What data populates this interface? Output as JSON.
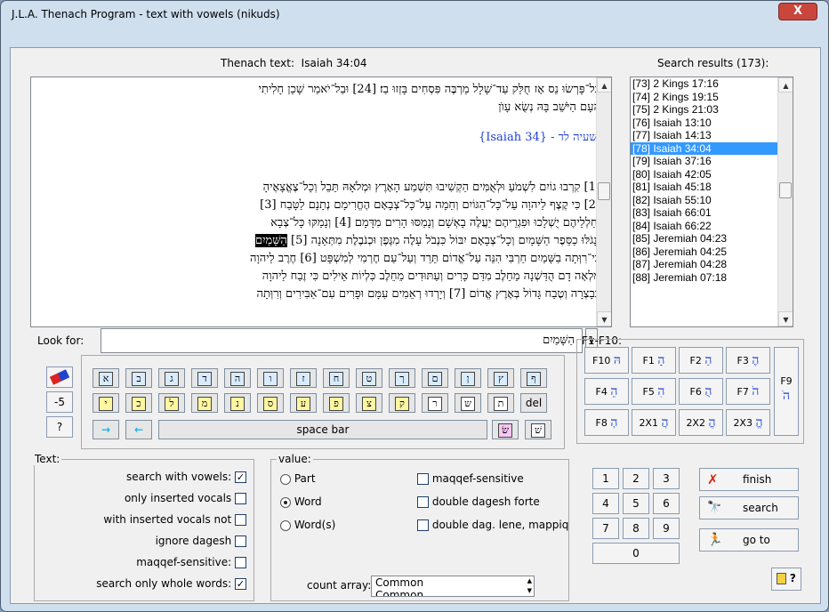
{
  "window": {
    "title": "J.L.A. Thenach Program - text with vowels (nikuds)",
    "close": "X"
  },
  "thenach": {
    "label": "Thenach text:",
    "ref": "Isaiah 34:04",
    "lines": [
      "בַּל־פָּרְשׂוּ נֵס אָז חֻלַּק עַד־שָׁלָל מַרְבֶּה פִּסְחִים בָּזְזוּ בַז׃ [24] וּבַל־יֹאמַר שָׁכֵן חָלִיתִי",
      "הָעָם הַיֹּשֵׁב בָּהּ נְשֻׂא עָוֺן",
      "ישעיה לד - {Isaiah 34}",
      "[1] קִרְבוּ גוֹיִם לִשְׁמֹעַ וּלְאֻמִּים הַקְשִׁיבוּ תִּשְׁמַע הָאָרֶץ וּמְלֹאָהּ תֵּבֵל וְכָל־צֶאֱצָאֶיהָ",
      "[2] כִּי קֶצֶף לַיהוָה עַל־כָּל־הַגּוֹיִם וְחֵמָה עַל־כָּל־צְבָאָם הֶחֱרִימָם נְתָנָם לַטָּבַח [3]",
      "וְחַלְלֵיהֶם יֻשְׁלָכוּ וּפִגְרֵיהֶם יַעֲלֶה בָאְשָׁם וְנָמַסּוּ הָרִים מִדָּמָם [4] וְנָמַקּוּ כָּל־צְבָא",
      "וְנָגֹלּוּ כַסֵּפֶר הַשָּׁמָיִם וְכָל־צְבָאָם יִבּוֹל כִּנְבֹל עָלֶה מִגֶּפֶן וּכְנֹבֶלֶת מִתְּאֵנָה [5]",
      "כִּי־רִוְּתָה בַשָּׁמַיִם חַרְבִּי הִנֵּה עַל־אֱדוֹם תֵּרֵד וְעַל־עַם חֶרְמִי לְמִשְׁפָּט [6] חֶרֶב לַיהוָה",
      "מָלְאָה דָם הֻדַּשְׁנָה מֵחֵלֶב מִדַּם כָּרִים וְעַתּוּדִים מֵחֵלֶב כִּלְיוֹת אֵילִים כִּי זֶבַח לַיהוָה",
      "בְּבָצְרָה וְטֶבַח גָּדוֹל בְּאֶרֶץ אֱדוֹם [7] וְיָרְדוּ רְאֵמִים עִמָּם וּפָרִים עִם־אַבִּירִים וְרִוְּתָה"
    ],
    "highlight": "הַשָּׁמַיִם"
  },
  "results": {
    "label": "Search results (173):",
    "items": [
      "[73] 2 Kings 17:16",
      "[74] 2 Kings 19:15",
      "[75] 2 Kings 21:03",
      "[76] Isaiah 13:10",
      "[77] Isaiah 14:13",
      "[78] Isaiah 34:04",
      "[79] Isaiah 37:16",
      "[80] Isaiah 42:05",
      "[81] Isaiah 45:18",
      "[82] Isaiah 55:10",
      "[83] Isaiah 66:01",
      "[84] Isaiah 66:22",
      "[85] Jeremiah 04:23",
      "[86] Jeremiah 04:25",
      "[87] Jeremiah 04:28",
      "[88] Jeremiah 07:18"
    ],
    "selected_index": 5
  },
  "lookfor": {
    "label": "Look for:",
    "value": "הַשָּׁמַיִם",
    "dropdown": "v"
  },
  "keyboard": {
    "row1": [
      "א",
      "ב",
      "ג",
      "ד",
      "ה",
      "ו",
      "ז",
      "ח",
      "ט",
      "ך",
      "ם",
      "ן",
      "ץ",
      "ף"
    ],
    "row2": [
      "י",
      "כ",
      "ל",
      "מ",
      "נ",
      "ס",
      "ע",
      "פ",
      "צ",
      "ק",
      "ר",
      "ש",
      "ת"
    ],
    "del": "del",
    "space": "space bar",
    "sin": "שׂ",
    "shin": "שׁ",
    "arrow_right": "→",
    "arrow_left": "←",
    "left_buttons": [
      "-5",
      "?"
    ]
  },
  "fkeys": {
    "label": "F1-F10:",
    "keys": [
      {
        "name": "F10",
        "glyph": "הּ"
      },
      {
        "name": "F1",
        "glyph": "הָ"
      },
      {
        "name": "F2",
        "glyph": "הַ"
      },
      {
        "name": "F3",
        "glyph": "הֶ"
      },
      {
        "name": "F4",
        "glyph": "הֵ"
      },
      {
        "name": "F5",
        "glyph": "הִ"
      },
      {
        "name": "F6",
        "glyph": "הֻ"
      },
      {
        "name": "F7",
        "glyph": "הֹ"
      },
      {
        "name": "F8",
        "glyph": "הְ"
      },
      {
        "name": "2X1",
        "glyph": "הֲ"
      },
      {
        "name": "2X2",
        "glyph": "הֳ"
      },
      {
        "name": "2X3",
        "glyph": "הֱ"
      }
    ],
    "f9": {
      "name": "F9",
      "glyph": "הׂ"
    }
  },
  "text_options": {
    "title": "Text:",
    "items": [
      {
        "label": "search with vowels:",
        "checked": true
      },
      {
        "label": "only inserted vocals",
        "checked": false
      },
      {
        "label": "with inserted vocals not",
        "checked": false
      },
      {
        "label": "ignore dagesh",
        "checked": false
      },
      {
        "label": "maqqef-sensitive:",
        "checked": false
      },
      {
        "label": "search only whole words:",
        "checked": true
      }
    ]
  },
  "value_options": {
    "title": "value:",
    "radios": [
      {
        "label": "Part",
        "checked": false
      },
      {
        "label": "Word",
        "checked": true
      },
      {
        "label": "Word(s)",
        "checked": false
      }
    ],
    "checks": [
      {
        "label": "maqqef-sensitive",
        "checked": false
      },
      {
        "label": "double dagesh forte",
        "checked": false
      },
      {
        "label": "double dag. lene, mappiq",
        "checked": false
      }
    ],
    "count_label": "count array:",
    "count_value": "Common",
    "count_value2": "Common"
  },
  "numpad": [
    "1",
    "2",
    "3",
    "4",
    "5",
    "6",
    "7",
    "8",
    "9",
    "0"
  ],
  "actions": {
    "finish": "finish",
    "search": "search",
    "goto": "go to",
    "help": "?"
  },
  "check_mark": "✓"
}
